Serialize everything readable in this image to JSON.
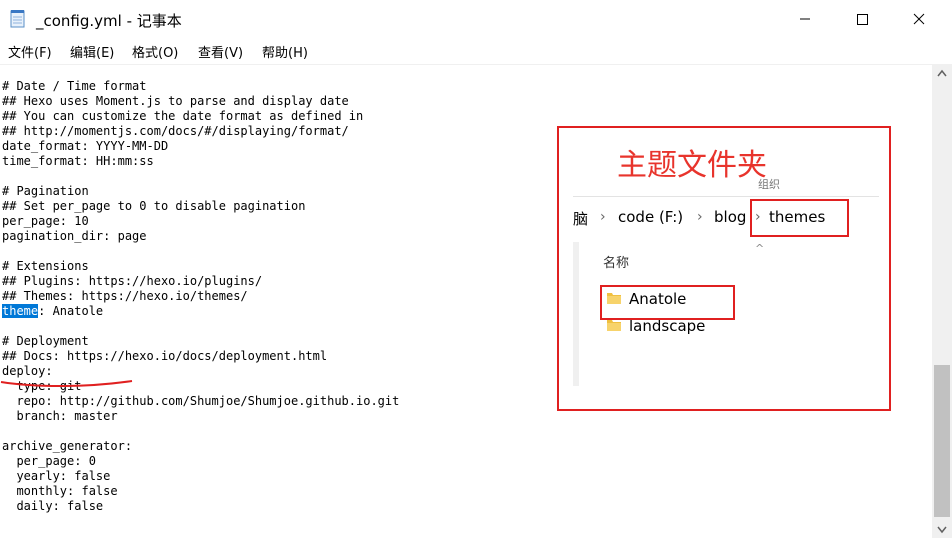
{
  "window": {
    "title": "_config.yml - 记事本",
    "app_icon": "notepad-icon",
    "controls": {
      "minimize": "minimize-icon",
      "maximize": "maximize-icon",
      "close": "close-icon"
    }
  },
  "menu": {
    "items": [
      "文件(F)",
      "编辑(E)",
      "格式(O)",
      "查看(V)",
      "帮助(H)"
    ]
  },
  "editor": {
    "lines": [
      "# Date / Time format",
      "## Hexo uses Moment.js to parse and display date",
      "## You can customize the date format as defined in",
      "## http://momentjs.com/docs/#/displaying/format/",
      "date_format: YYYY-MM-DD",
      "time_format: HH:mm:ss",
      "",
      "# Pagination",
      "## Set per_page to 0 to disable pagination",
      "per_page: 10",
      "pagination_dir: page",
      "",
      "# Extensions",
      "## Plugins: https://hexo.io/plugins/",
      "## Themes: https://hexo.io/themes/",
      "theme: Anatole",
      "",
      "# Deployment",
      "## Docs: https://hexo.io/docs/deployment.html",
      "deploy:",
      "  type: git",
      "  repo: http://github.com/Shumjoe/Shumjoe.github.io.git",
      "  branch: master",
      "",
      "archive_generator:",
      "  per_page: 0",
      "  yearly: false",
      "  monthly: false",
      "  daily: false"
    ],
    "selected_text": "theme",
    "selected_line_rest": ": Anatole",
    "selection_color": "#0078d7"
  },
  "annotation": {
    "title": "主题文件夹",
    "title_color": "#e8342c",
    "border_color": "#e02020",
    "explorer_top_text": "组织",
    "breadcrumbs": [
      "脑",
      "code (F:)",
      "blog",
      "themes"
    ],
    "column_header": "名称",
    "folders": [
      "Anatole",
      "landscape"
    ],
    "folder_icon_color": "#f0c040"
  }
}
